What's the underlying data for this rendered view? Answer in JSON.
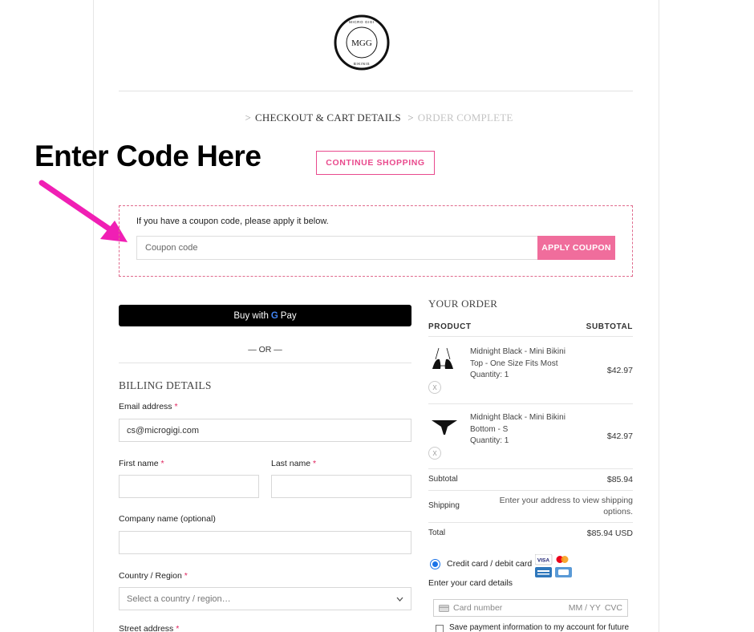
{
  "brand": {
    "logo_monogram": "MGG",
    "logo_ring_text_top": "MICRO GIGI",
    "logo_ring_text_bottom": "BIKINIS"
  },
  "breadcrumb": {
    "step1": "CHECKOUT & CART DETAILS",
    "step2": "ORDER COMPLETE",
    "separator": ">"
  },
  "annotation": {
    "text": "Enter Code Here",
    "arrow_color": "#f01fb4"
  },
  "continue_shopping": "CONTINUE SHOPPING",
  "coupon": {
    "prompt": "If you have a coupon code, please apply it below.",
    "placeholder": "Coupon code",
    "apply_label": "APPLY COUPON"
  },
  "gpay": {
    "prefix": "Buy with",
    "g": "G",
    "pay": "Pay"
  },
  "or_divider": "— OR —",
  "billing": {
    "heading": "BILLING DETAILS",
    "email_label": "Email address",
    "email_value": "cs@microgigi.com",
    "first_name_label": "First name",
    "last_name_label": "Last name",
    "company_label": "Company name (optional)",
    "country_label": "Country / Region",
    "country_placeholder": "Select a country / region…",
    "street_label": "Street address",
    "required_mark": "*"
  },
  "order": {
    "heading": "YOUR ORDER",
    "col_product": "PRODUCT",
    "col_subtotal": "SUBTOTAL",
    "items": [
      {
        "name_line1": "Midnight Black - Mini Bikini",
        "name_line2": "Top - One Size Fits Most",
        "quantity": "Quantity: 1",
        "price": "$42.97",
        "remove": "X"
      },
      {
        "name_line1": "Midnight Black - Mini Bikini",
        "name_line2": "Bottom - S",
        "quantity": "Quantity: 1",
        "price": "$42.97",
        "remove": "X"
      }
    ],
    "subtotal_label": "Subtotal",
    "subtotal_value": "$85.94",
    "shipping_label": "Shipping",
    "shipping_value_line1": "Enter your address to view shipping",
    "shipping_value_line2": "options.",
    "total_label": "Total",
    "total_value": "$85.94 USD"
  },
  "payment": {
    "method_label": "Credit card / debit card",
    "card_details_label": "Enter your card details",
    "card_number_placeholder": "Card number",
    "expiry_placeholder": "MM / YY",
    "cvc_placeholder": "CVC",
    "save_label": "Save payment information to my account for future",
    "card_icons": [
      "visa-icon",
      "mastercard-icon",
      "amex-icon",
      "card-generic-icon"
    ]
  },
  "colors": {
    "accent_pink": "#f06d9c",
    "accent_border": "#e94a8d"
  }
}
